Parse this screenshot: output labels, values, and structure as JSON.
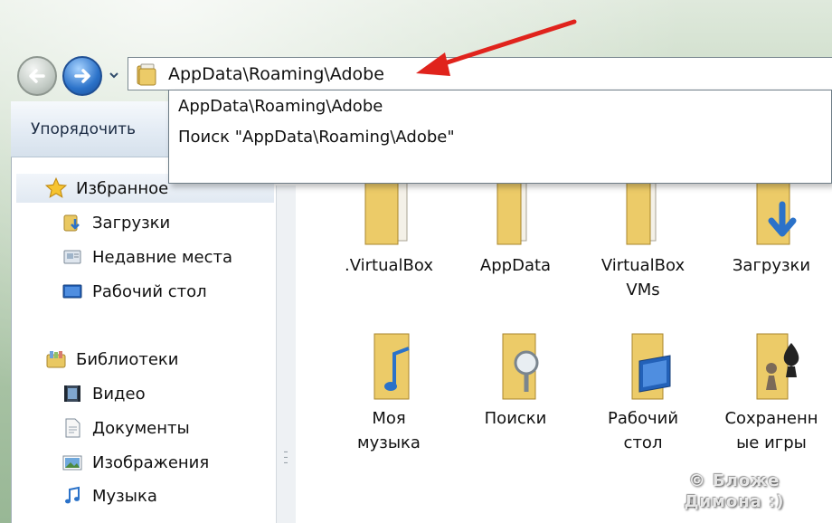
{
  "address": {
    "path": "AppData\\Roaming\\Adobe"
  },
  "toolbar": {
    "organize_label": "Упорядочить",
    "organize_dropdown": "▼"
  },
  "suggestions": [
    {
      "label": "AppData\\Roaming\\Adobe"
    },
    {
      "label": "Поиск \"AppData\\Roaming\\Adobe\""
    }
  ],
  "nav": {
    "favorites": "Избранное",
    "downloads": "Загрузки",
    "recent": "Недавние места",
    "desktop": "Рабочий стол",
    "libraries": "Библиотеки",
    "video": "Видео",
    "documents": "Документы",
    "images": "Изображения",
    "music": "Музыка"
  },
  "files": [
    {
      "line1": ".VirtualBox",
      "line2": ""
    },
    {
      "line1": "AppData",
      "line2": ""
    },
    {
      "line1": "VirtualBox",
      "line2": "VMs"
    },
    {
      "line1": "Загрузки",
      "line2": ""
    },
    {
      "line1": "Моя",
      "line2": "музыка"
    },
    {
      "line1": "Поиски",
      "line2": ""
    },
    {
      "line1": "Рабочий",
      "line2": "стол"
    },
    {
      "line1": "Сохраненн",
      "line2": "ые игры"
    }
  ],
  "watermark": {
    "line1": "© Бложе",
    "line2": "Димона :)"
  },
  "colors": {
    "arrow": "#e0231c",
    "folder": "#e9c862",
    "accent_blue": "#2b72c9"
  }
}
